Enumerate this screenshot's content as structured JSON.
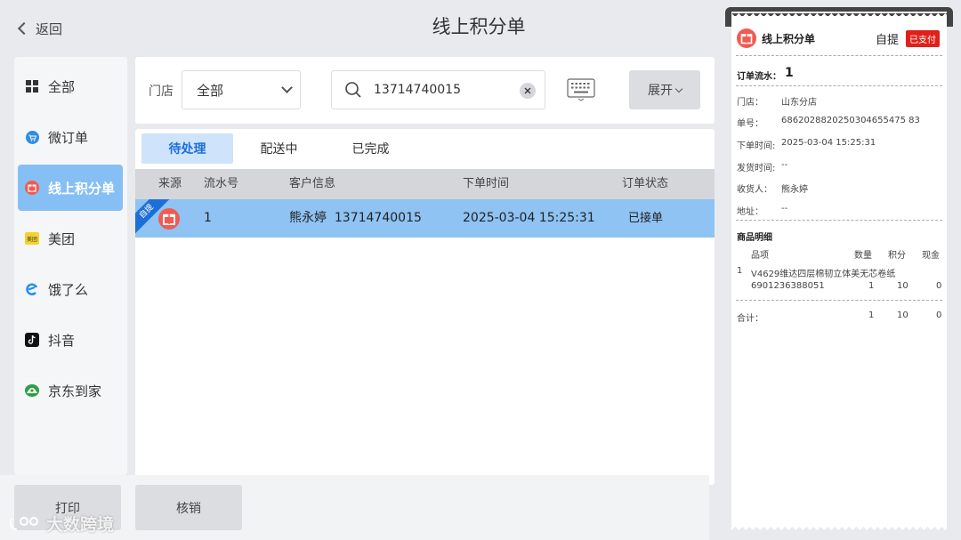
{
  "header": {
    "back_label": "返回",
    "title": "线上积分单"
  },
  "sidebar": {
    "items": [
      {
        "label": "全部",
        "icon": "grid-icon"
      },
      {
        "label": "微订单",
        "icon": "cart-icon"
      },
      {
        "label": "线上积分单",
        "icon": "gift-icon",
        "active": true
      },
      {
        "label": "美团",
        "icon": "meituan-icon"
      },
      {
        "label": "饿了么",
        "icon": "eleme-icon"
      },
      {
        "label": "抖音",
        "icon": "douyin-icon"
      },
      {
        "label": "京东到家",
        "icon": "jd-daojia-icon"
      }
    ]
  },
  "filter": {
    "store_label": "门店",
    "store_value": "全部",
    "search_value": "13714740015",
    "expand_label": "展开"
  },
  "tabs": [
    "待处理",
    "配送中",
    "已完成"
  ],
  "table": {
    "headers": [
      "来源",
      "流水号",
      "客户信息",
      "下单时间",
      "订单状态"
    ],
    "rows": [
      {
        "ribbon": "自提",
        "serial": "1",
        "customer": "熊永婷  13714740015",
        "time": "2025-03-04 15:25:31",
        "status": "已接单"
      }
    ]
  },
  "actions": {
    "print_label": "打印",
    "verify_label": "核销"
  },
  "watermark": "大数跨境",
  "receipt": {
    "title": "线上积分单",
    "pickup": "自提",
    "paid_badge": "已支付",
    "serial_label": "订单流水：",
    "serial_value": "1",
    "store_label": "门店：",
    "store_value": "山东分店",
    "order_no_label": "单号：",
    "order_no_value": "6862028820250304655475 83",
    "order_time_label": "下单时间:",
    "order_time_value": "2025-03-04 15:25:31",
    "ship_time_label": "发货时间:",
    "ship_time_value": "--",
    "receiver_label": "收货人：",
    "receiver_value": "熊永婷",
    "address_label": "地址：",
    "address_value": "--",
    "detail_title": "商品明细",
    "col_item": "品项",
    "col_qty": "数量",
    "col_points": "积分",
    "col_cash": "现金",
    "item_index": "1",
    "item_name": "V4629维达四层棉韧立体美无芯卷纸",
    "item_code": "6901236388051",
    "item_qty": "1",
    "item_points": "10",
    "item_cash": "0",
    "total_label": "合计：",
    "total_qty": "1",
    "total_points": "10",
    "total_cash": "0"
  },
  "colors": {
    "accent": "#1d6fd8",
    "selected_row": "#8ec3f3",
    "paid_badge": "#e0201b"
  }
}
